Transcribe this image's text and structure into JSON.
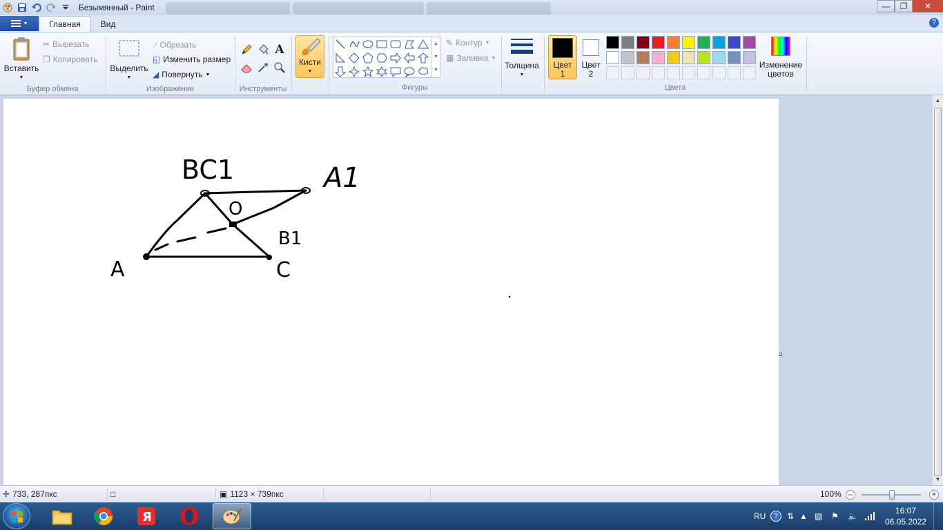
{
  "window": {
    "title": "Безымянный - Paint"
  },
  "ribbon_tabs": {
    "home": "Главная",
    "view": "Вид"
  },
  "clipboard": {
    "paste": "Вставить",
    "cut": "Вырезать",
    "copy": "Копировать",
    "group_label": "Буфер обмена"
  },
  "image": {
    "select": "Выделить",
    "crop": "Обрезать",
    "resize": "Изменить размер",
    "rotate": "Повернуть",
    "group_label": "Изображение"
  },
  "tools": {
    "group_label": "Инструменты"
  },
  "brushes": {
    "label": "Кисти"
  },
  "shapes": {
    "outline": "Контур",
    "fill": "Заливка",
    "group_label": "Фигуры"
  },
  "size": {
    "label": "Толщина"
  },
  "colors": {
    "color1": "Цвет",
    "color1_num": "1",
    "color2": "Цвет",
    "color2_num": "2",
    "edit_line1": "Изменение",
    "edit_line2": "цветов",
    "group_label": "Цвета",
    "active_color1": "#000000",
    "palette_row1": [
      "#000000",
      "#7f7f7f",
      "#880015",
      "#ed1c24",
      "#ff7f27",
      "#fff200",
      "#22b14c",
      "#00a2e8",
      "#3f48cc",
      "#a349a4"
    ],
    "palette_row2": [
      "#ffffff",
      "#c3c3c3",
      "#b97a57",
      "#ffaec9",
      "#ffc90e",
      "#efe4b0",
      "#b5e61d",
      "#99d9ea",
      "#7092be",
      "#c8bfe7"
    ]
  },
  "drawing": {
    "label_bc1": "BC1",
    "label_a1": "A1",
    "label_o": "O",
    "label_b1": "B1",
    "label_a": "A",
    "label_c": "C"
  },
  "status": {
    "cursor_pos": "733, 287пкс",
    "canvas_size": "1123 × 739пкс",
    "zoom": "100%"
  },
  "taskbar": {
    "lang": "RU",
    "time": "16:07",
    "date": "06.05.2022"
  }
}
